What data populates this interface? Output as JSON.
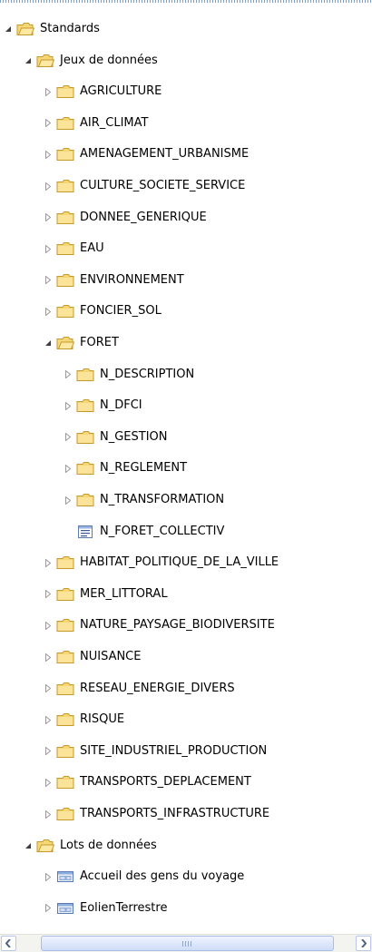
{
  "tree": [
    {
      "label": "Standards",
      "level": 0,
      "icon": "folder-open-icon",
      "expander": "expanded"
    },
    {
      "label": "Jeux de données",
      "level": 1,
      "icon": "folder-open-icon",
      "expander": "expanded"
    },
    {
      "label": "AGRICULTURE",
      "level": 2,
      "icon": "folder-icon",
      "expander": "collapsed"
    },
    {
      "label": "AIR_CLIMAT",
      "level": 2,
      "icon": "folder-icon",
      "expander": "collapsed"
    },
    {
      "label": "AMENAGEMENT_URBANISME",
      "level": 2,
      "icon": "folder-icon",
      "expander": "collapsed"
    },
    {
      "label": "CULTURE_SOCIETE_SERVICE",
      "level": 2,
      "icon": "folder-icon",
      "expander": "collapsed"
    },
    {
      "label": "DONNEE_GENERIQUE",
      "level": 2,
      "icon": "folder-icon",
      "expander": "collapsed"
    },
    {
      "label": "EAU",
      "level": 2,
      "icon": "folder-icon",
      "expander": "collapsed"
    },
    {
      "label": "ENVIRONNEMENT",
      "level": 2,
      "icon": "folder-icon",
      "expander": "collapsed"
    },
    {
      "label": "FONCIER_SOL",
      "level": 2,
      "icon": "folder-icon",
      "expander": "collapsed"
    },
    {
      "label": "FORET",
      "level": 2,
      "icon": "folder-open-icon",
      "expander": "expanded"
    },
    {
      "label": "N_DESCRIPTION",
      "level": 3,
      "icon": "folder-icon",
      "expander": "collapsed"
    },
    {
      "label": "N_DFCI",
      "level": 3,
      "icon": "folder-icon",
      "expander": "collapsed"
    },
    {
      "label": "N_GESTION",
      "level": 3,
      "icon": "folder-icon",
      "expander": "collapsed"
    },
    {
      "label": "N_REGLEMENT",
      "level": 3,
      "icon": "folder-icon",
      "expander": "collapsed"
    },
    {
      "label": "N_TRANSFORMATION",
      "level": 3,
      "icon": "folder-icon",
      "expander": "collapsed"
    },
    {
      "label": "N_FORET_COLLECTIV",
      "level": 3,
      "icon": "table-icon",
      "expander": "none"
    },
    {
      "label": "HABITAT_POLITIQUE_DE_LA_VILLE",
      "level": 2,
      "icon": "folder-icon",
      "expander": "collapsed"
    },
    {
      "label": "MER_LITTORAL",
      "level": 2,
      "icon": "folder-icon",
      "expander": "collapsed"
    },
    {
      "label": "NATURE_PAYSAGE_BIODIVERSITE",
      "level": 2,
      "icon": "folder-icon",
      "expander": "collapsed"
    },
    {
      "label": "NUISANCE",
      "level": 2,
      "icon": "folder-icon",
      "expander": "collapsed"
    },
    {
      "label": "RESEAU_ENERGIE_DIVERS",
      "level": 2,
      "icon": "folder-icon",
      "expander": "collapsed"
    },
    {
      "label": "RISQUE",
      "level": 2,
      "icon": "folder-icon",
      "expander": "collapsed"
    },
    {
      "label": "SITE_INDUSTRIEL_PRODUCTION",
      "level": 2,
      "icon": "folder-icon",
      "expander": "collapsed"
    },
    {
      "label": "TRANSPORTS_DEPLACEMENT",
      "level": 2,
      "icon": "folder-icon",
      "expander": "collapsed"
    },
    {
      "label": "TRANSPORTS_INFRASTRUCTURE",
      "level": 2,
      "icon": "folder-icon",
      "expander": "collapsed"
    },
    {
      "label": "Lots de données",
      "level": 1,
      "icon": "folder-open-icon",
      "expander": "expanded"
    },
    {
      "label": "Accueil des gens du voyage",
      "level": 2,
      "icon": "layer-package-icon",
      "expander": "collapsed"
    },
    {
      "label": "EolienTerrestre",
      "level": 2,
      "icon": "layer-package-icon",
      "expander": "collapsed"
    }
  ],
  "scrollbar": {
    "left_icon": "scroll-left-arrow-icon",
    "right_icon": "scroll-right-arrow-icon",
    "grip_icon": "scroll-grip-icon"
  }
}
